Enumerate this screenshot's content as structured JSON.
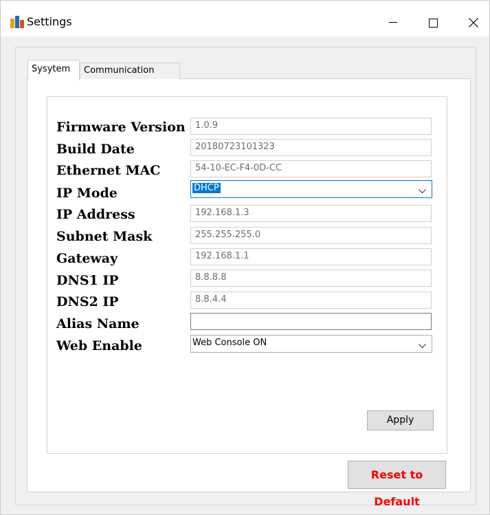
{
  "window": {
    "title": "Settings",
    "app_icon": "app-logo-icon",
    "controls": {
      "minimize_icon": "minimize-icon",
      "maximize_icon": "maximize-icon",
      "close_icon": "close-icon"
    }
  },
  "tabs": [
    {
      "label": "Sysytem",
      "active": true
    },
    {
      "label": "Communication",
      "active": false
    }
  ],
  "fields": {
    "firmware_version": {
      "label": "Firmware Version",
      "value": "1.0.9"
    },
    "build_date": {
      "label": "Build Date",
      "value": "20180723101323"
    },
    "ethernet_mac": {
      "label": "Ethernet MAC",
      "value": "54-10-EC-F4-0D-CC"
    },
    "ip_mode": {
      "label": "IP Mode",
      "value": "DHCP"
    },
    "ip_address": {
      "label": "IP Address",
      "value": "192.168.1.3"
    },
    "subnet_mask": {
      "label": "Subnet Mask",
      "value": "255.255.255.0"
    },
    "gateway": {
      "label": "Gateway",
      "value": "192.168.1.1"
    },
    "dns1_ip": {
      "label": "DNS1 IP",
      "value": "8.8.8.8"
    },
    "dns2_ip": {
      "label": "DNS2 IP",
      "value": "8.8.4.4"
    },
    "alias_name": {
      "label": "Alias Name",
      "value": ""
    },
    "web_enable": {
      "label": "Web Enable",
      "value": "Web Console ON"
    }
  },
  "buttons": {
    "apply": "Apply",
    "reset": "Reset to Default"
  },
  "colors": {
    "selection": "#0078d7",
    "reset_text": "#ff0000",
    "readonly_text": "#6d6d6d"
  }
}
